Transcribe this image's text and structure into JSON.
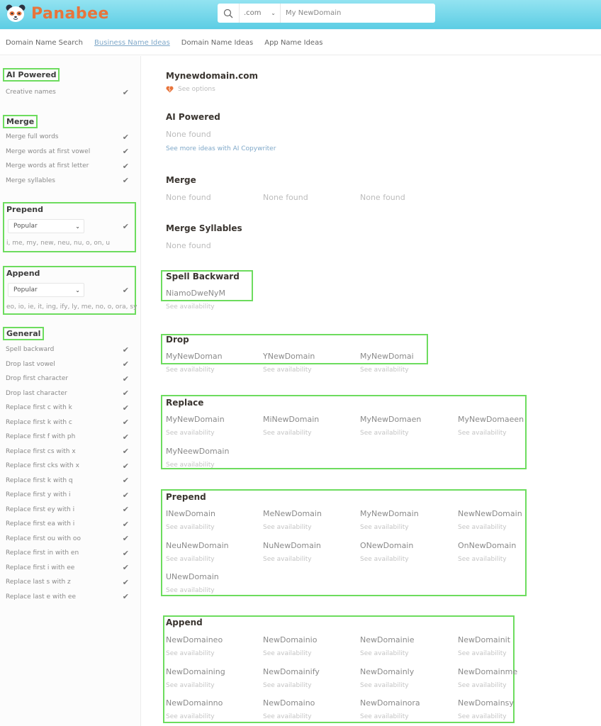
{
  "header": {
    "brand": "Panabee",
    "search": {
      "tld": ".com",
      "value": "My NewDomain"
    }
  },
  "nav": {
    "items": [
      {
        "label": "Domain Name Search",
        "active": false
      },
      {
        "label": "Business Name Ideas",
        "active": true
      },
      {
        "label": "Domain Name Ideas",
        "active": false
      },
      {
        "label": "App Name Ideas",
        "active": false
      }
    ]
  },
  "sidebar": {
    "ai_powered": {
      "title": "AI Powered",
      "items": [
        "Creative names"
      ]
    },
    "merge": {
      "title": "Merge",
      "items": [
        "Merge full words",
        "Merge words at first vowel",
        "Merge words at first letter",
        "Merge syllables"
      ]
    },
    "prepend": {
      "title": "Prepend",
      "select": "Popular",
      "list": "i, me, my, new, neu, nu, o, on, u"
    },
    "append": {
      "title": "Append",
      "select": "Popular",
      "list": "eo, io, ie, it, ing, ify, ly, me, no, o, ora, sy"
    },
    "general": {
      "title": "General",
      "items": [
        "Spell backward",
        "Drop last vowel",
        "Drop first character",
        "Drop last character",
        "Replace first c with k",
        "Replace first k with c",
        "Replace first f with ph",
        "Replace first cs with x",
        "Replace first cks with x",
        "Replace first k with q",
        "Replace first y with i",
        "Replace first ey with i",
        "Replace first ea with i",
        "Replace first ou with oo",
        "Replace first in with en",
        "Replace first i with ee",
        "Replace last s with z",
        "Replace last e with ee"
      ]
    }
  },
  "main": {
    "domain": {
      "name": "Mynewdomain.com",
      "see_options": "See options"
    },
    "ai_powered": {
      "title": "AI Powered",
      "none": "None found",
      "link": "See more ideas with AI Copywriter"
    },
    "merge": {
      "title": "Merge",
      "none": [
        "None found",
        "None found",
        "None found"
      ]
    },
    "merge_syllables": {
      "title": "Merge Syllables",
      "none": "None found"
    },
    "availability_label": "See availability",
    "spell_backward": {
      "title": "Spell Backward",
      "names": [
        "NiamoDweNyM"
      ]
    },
    "drop": {
      "title": "Drop",
      "names": [
        "MyNewDoman",
        "YNewDomain",
        "MyNewDomai"
      ]
    },
    "replace": {
      "title": "Replace",
      "names": [
        "MyNewDomain",
        "MiNewDomain",
        "MyNewDomaen",
        "MyNewDomaeen",
        "MyNeewDomain"
      ]
    },
    "prepend": {
      "title": "Prepend",
      "names": [
        "INewDomain",
        "MeNewDomain",
        "MyNewDomain",
        "NewNewDomain",
        "NeuNewDomain",
        "NuNewDomain",
        "ONewDomain",
        "OnNewDomain",
        "UNewDomain"
      ]
    },
    "append": {
      "title": "Append",
      "names": [
        "NewDomaineo",
        "NewDomainio",
        "NewDomainie",
        "NewDomainit",
        "NewDomaining",
        "NewDomainify",
        "NewDomainly",
        "NewDomainme",
        "NewDomainno",
        "NewDomaino",
        "NewDomainora",
        "NewDomainsy"
      ]
    }
  },
  "colors": {
    "brand": "#e8743b",
    "highlight_box": "#6ddc5e",
    "link": "#7fa8c9"
  }
}
